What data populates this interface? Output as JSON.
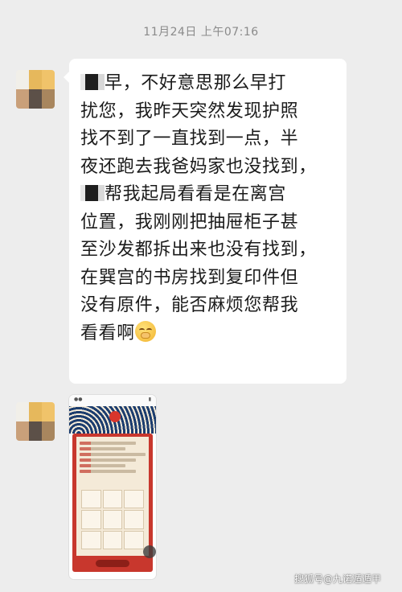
{
  "timestamp": "11月24日 上午07:16",
  "message_text": {
    "line1": "早，不好意思那么早打",
    "line2": "扰您，我昨天突然发现护照",
    "line3": "找不到了一直找到一点，半",
    "line4": "夜还跑去我爸妈家也没找到，",
    "line5": "帮我起局看看是在离宫",
    "line6": "位置，我刚刚把抽屉柜子甚",
    "line7": "至沙发都拆出来也没有找到，",
    "line8": "在巽宫的书房找到复印件但",
    "line9": "没有原件，能否麻烦您帮我",
    "line10": "看看啊"
  },
  "emoji": "worried-face-icon",
  "image_message": {
    "description_icon": "qimen-chart-screenshot"
  },
  "watermark": "搜狐号@九诺遁遁甲",
  "colors": {
    "background": "#ededed",
    "bubble": "#ffffff",
    "text": "#1b1b1b",
    "timestamp": "#8a8a8a",
    "scroll_red": "#c8372d",
    "wave_blue": "#1c3d6e"
  }
}
